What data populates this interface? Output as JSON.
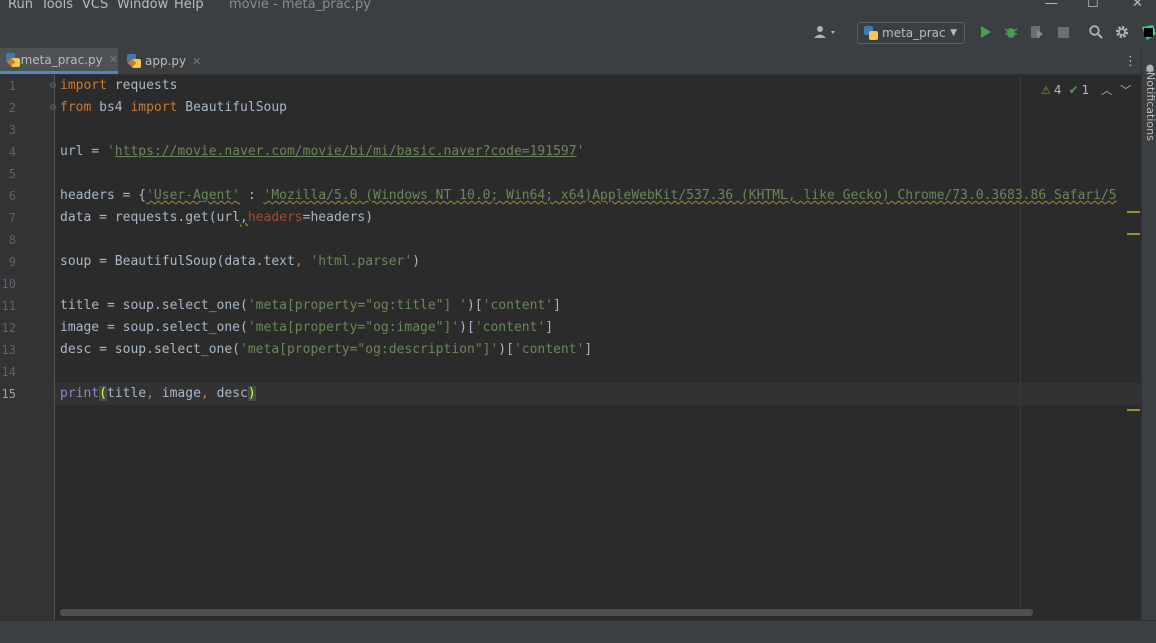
{
  "menubar": {
    "items": [
      "Run",
      "Tools",
      "VCS",
      "Window",
      "Help"
    ],
    "window_title": "movie - meta_prac.py"
  },
  "toolbar": {
    "run_config": "meta_prac",
    "icons": [
      "account-icon",
      "run-icon",
      "debug-icon",
      "coverage-icon",
      "stop-icon",
      "search-icon",
      "gear-icon",
      "pycharm-logo-icon"
    ]
  },
  "tabs": [
    {
      "label": "meta_prac.py",
      "active": true
    },
    {
      "label": "app.py",
      "active": false
    }
  ],
  "inspections": {
    "warnings": "4",
    "typos": "1"
  },
  "notifications_label": "Notifications",
  "editor": {
    "current_line": "15",
    "line_numbers": [
      "1",
      "2",
      "3",
      "4",
      "5",
      "6",
      "7",
      "8",
      "9",
      "10",
      "11",
      "12",
      "13",
      "14",
      "15"
    ],
    "lines": {
      "l1_kw": "import",
      "l1_rest": " requests",
      "l2_kw1": "from",
      "l2_mid": " bs4 ",
      "l2_kw2": "import",
      "l2_rest": " BeautifulSoup",
      "l4_a": "url = ",
      "l4_q": "'",
      "l4_url": "https://movie.naver.com/movie/bi/mi/basic.naver?code=191597",
      "l4_q2": "'",
      "l6_a": "headers = {",
      "l6_key": "'User-Agent'",
      "l6_colon": " : ",
      "l6_val": "'Mozilla/5.0 (Windows NT 10.0; Win64; x64)AppleWebKit/537.36 (KHTML, like Gecko) Chrome/73.0.3683.86 Safari/5",
      "l7_a": "data = requests.get(url",
      "l7_comma": ",",
      "l7_param": "headers",
      "l7_rest": "=headers)",
      "l9_a": "soup = BeautifulSoup(data.text",
      "l9_comma": ", ",
      "l9_str": "'html.parser'",
      "l9_end": ")",
      "l11_a": "title = soup.select_one(",
      "l11_str": "'meta[property=\"og:title\"] '",
      "l11_b": ")[",
      "l11_str2": "'content'",
      "l11_end": "]",
      "l12_a": "image = soup.select_one(",
      "l12_str": "'meta[property=\"og:image\"]'",
      "l12_b": ")[",
      "l12_str2": "'content'",
      "l12_end": "]",
      "l13_a": "desc = soup.select_one(",
      "l13_str": "'meta[property=\"og:description\"]'",
      "l13_b": ")[",
      "l13_str2": "'content'",
      "l13_end": "]",
      "l15_fn": "print",
      "l15_open": "(",
      "l15_a": "title",
      "l15_c1": ", ",
      "l15_b": "image",
      "l15_c2": ", ",
      "l15_c": "desc",
      "l15_close": ")"
    }
  },
  "colors": {
    "keyword": "#cc7832",
    "string": "#6a8759",
    "param": "#aa4926",
    "builtin": "#8888c6",
    "default_text": "#a9b7c6",
    "background": "#2b2b2b"
  }
}
